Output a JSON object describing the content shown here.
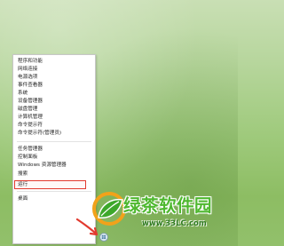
{
  "context_menu": {
    "items": [
      {
        "label": "程序和功能"
      },
      {
        "label": "网络连接"
      },
      {
        "label": "电源选项"
      },
      {
        "label": "事件查看器"
      },
      {
        "label": "系统"
      },
      {
        "label": "设备管理器"
      },
      {
        "label": "磁盘管理"
      },
      {
        "label": "计算机管理"
      },
      {
        "label": "命令提示符"
      },
      {
        "label": "命令提示符(管理员)"
      },
      {
        "label": "任务管理器"
      },
      {
        "label": "控制面板"
      },
      {
        "label": "Windows 资源管理器"
      },
      {
        "label": "搜索"
      },
      {
        "label": "运行",
        "highlighted": true
      },
      {
        "label": "桌面"
      }
    ]
  },
  "annotation": {
    "arrow_color": "#e23a2f",
    "highlight_color": "#e23a2f"
  },
  "watermark": {
    "title": "绿茶软件园",
    "url": "www.33LC.com",
    "color": "#4eb82f"
  }
}
